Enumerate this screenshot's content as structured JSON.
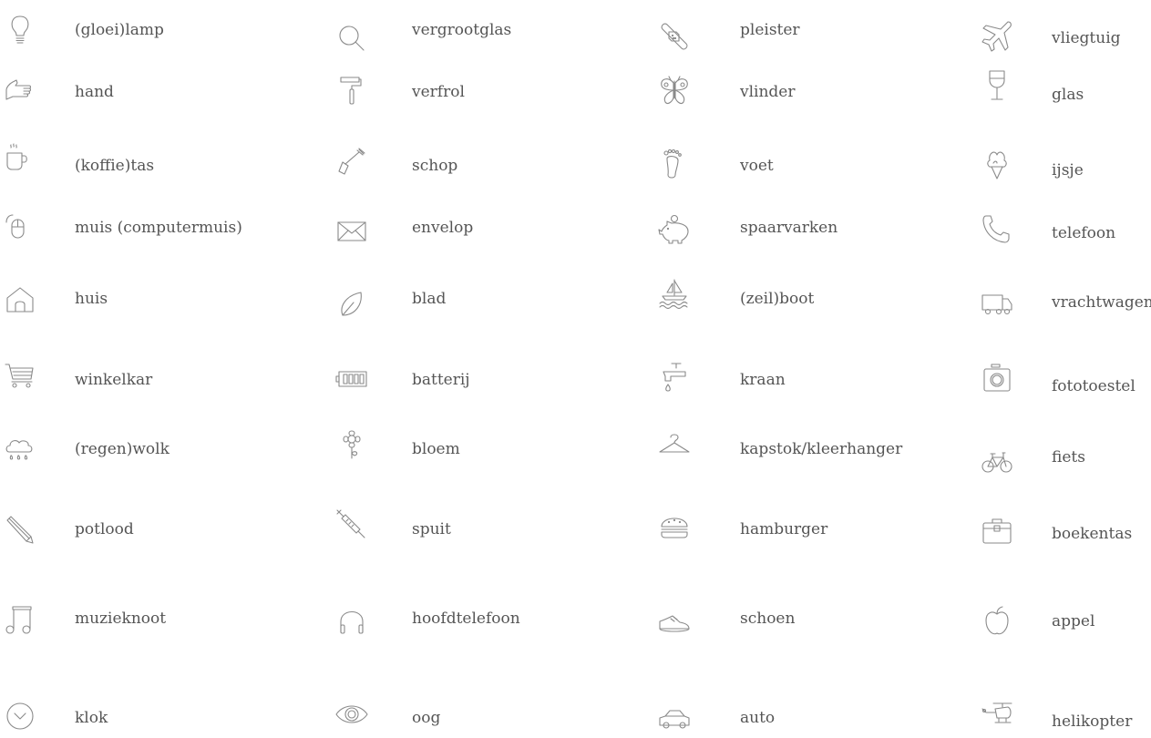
{
  "columns": [
    {
      "items": [
        {
          "name": "lightbulb",
          "label": "(gloei)lamp"
        },
        {
          "name": "hand",
          "label": "hand"
        },
        {
          "name": "coffee-cup",
          "label": "(koffie)tas"
        },
        {
          "name": "mouse",
          "label": "muis (computermuis)"
        },
        {
          "name": "house",
          "label": "huis"
        },
        {
          "name": "shopping-cart",
          "label": "winkelkar"
        },
        {
          "name": "rain-cloud",
          "label": "(regen)wolk"
        },
        {
          "name": "pencil",
          "label": "potlood"
        },
        {
          "name": "music-note",
          "label": "muzieknoot"
        },
        {
          "name": "clock",
          "label": "klok"
        }
      ]
    },
    {
      "items": [
        {
          "name": "magnifier",
          "label": "vergrootglas"
        },
        {
          "name": "paint-roller",
          "label": "verfrol"
        },
        {
          "name": "shovel",
          "label": "schop"
        },
        {
          "name": "envelope",
          "label": "envelop"
        },
        {
          "name": "leaf",
          "label": "blad"
        },
        {
          "name": "battery",
          "label": "batterij"
        },
        {
          "name": "flower",
          "label": "bloem"
        },
        {
          "name": "syringe",
          "label": "spuit"
        },
        {
          "name": "headphones",
          "label": "hoofdtelefoon"
        },
        {
          "name": "eye",
          "label": "oog"
        }
      ]
    },
    {
      "items": [
        {
          "name": "bandage",
          "label": "pleister"
        },
        {
          "name": "butterfly",
          "label": "vlinder"
        },
        {
          "name": "foot",
          "label": "voet"
        },
        {
          "name": "piggy-bank",
          "label": "spaarvarken"
        },
        {
          "name": "sailboat",
          "label": "(zeil)boot"
        },
        {
          "name": "faucet",
          "label": "kraan"
        },
        {
          "name": "hanger",
          "label": "kapstok/kleerhanger"
        },
        {
          "name": "hamburger",
          "label": "hamburger"
        },
        {
          "name": "shoe",
          "label": "schoen"
        },
        {
          "name": "car",
          "label": "auto"
        }
      ]
    },
    {
      "items": [
        {
          "name": "airplane",
          "label": "vliegtuig"
        },
        {
          "name": "wine-glass",
          "label": "glas"
        },
        {
          "name": "ice-cream",
          "label": "ijsje"
        },
        {
          "name": "telephone",
          "label": "telefoon"
        },
        {
          "name": "truck",
          "label": "vrachtwagen"
        },
        {
          "name": "camera",
          "label": "fototoestel"
        },
        {
          "name": "bicycle",
          "label": "fiets"
        },
        {
          "name": "briefcase",
          "label": "boekentas"
        },
        {
          "name": "apple",
          "label": "appel"
        },
        {
          "name": "helicopter",
          "label": "helikopter"
        }
      ]
    }
  ]
}
